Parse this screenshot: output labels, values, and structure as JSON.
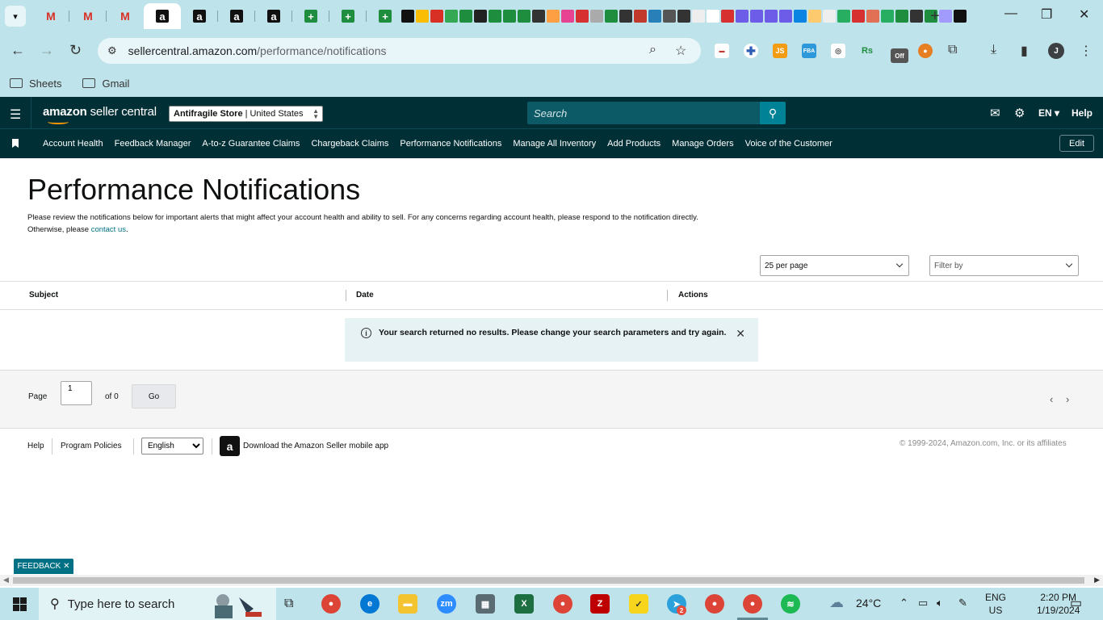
{
  "browser": {
    "url_host": "sellercentral.amazon.com",
    "url_path": "/performance/notifications",
    "bookmarks": [
      "Sheets",
      "Gmail"
    ],
    "profile_initial": "J",
    "ext_js_label": "JS",
    "ext_fba_label": "FBA",
    "ext_rs_label": "Rs",
    "ext_off_label": "Off"
  },
  "header": {
    "logo_bold": "amazon",
    "logo_light": " seller central",
    "store_name": "Antifragile Store",
    "store_region": "| United States",
    "search_placeholder": "Search",
    "language": "EN",
    "help": "Help"
  },
  "nav": {
    "links": [
      "Account Health",
      "Feedback Manager",
      "A-to-z Guarantee Claims",
      "Chargeback Claims",
      "Performance Notifications",
      "Manage All Inventory",
      "Add Products",
      "Manage Orders",
      "Voice of the Customer"
    ],
    "edit": "Edit"
  },
  "main": {
    "title": "Performance Notifications",
    "intro_text": "Please review the notifications below for important alerts that might affect your account health and ability to sell. For any concerns regarding account health, please respond to the notification directly. Otherwise, please ",
    "intro_link": "contact us",
    "intro_end": ".",
    "per_page": "25 per page",
    "filter_by": "Filter by",
    "columns": [
      "Subject",
      "Date",
      "Actions"
    ],
    "alert_message": "Your search returned no results. Please change your search parameters and try again."
  },
  "pager": {
    "page_label": "Page",
    "page_value": "1",
    "of_label": "of 0",
    "go": "Go"
  },
  "footer": {
    "help": "Help",
    "program_policies": "Program Policies",
    "language": "English",
    "download_app": "Download the Amazon Seller mobile app",
    "copyright": "© 1999-2024, Amazon.com, Inc. or its affiliates"
  },
  "feedback_tab": "FEEDBACK",
  "taskbar": {
    "search_placeholder": "Type here to search",
    "weather": "24°C",
    "ime_line1": "ENG",
    "ime_line2": "US",
    "time": "2:20 PM",
    "date": "1/19/2024",
    "telegram_badge": "2",
    "zoom_label": "zm"
  },
  "colors": {
    "seller_header": "#002f36",
    "search_button": "#008296",
    "link": "#007185",
    "alert_bg": "#e6f2f4",
    "chrome_bg": "#bfe3ea"
  }
}
